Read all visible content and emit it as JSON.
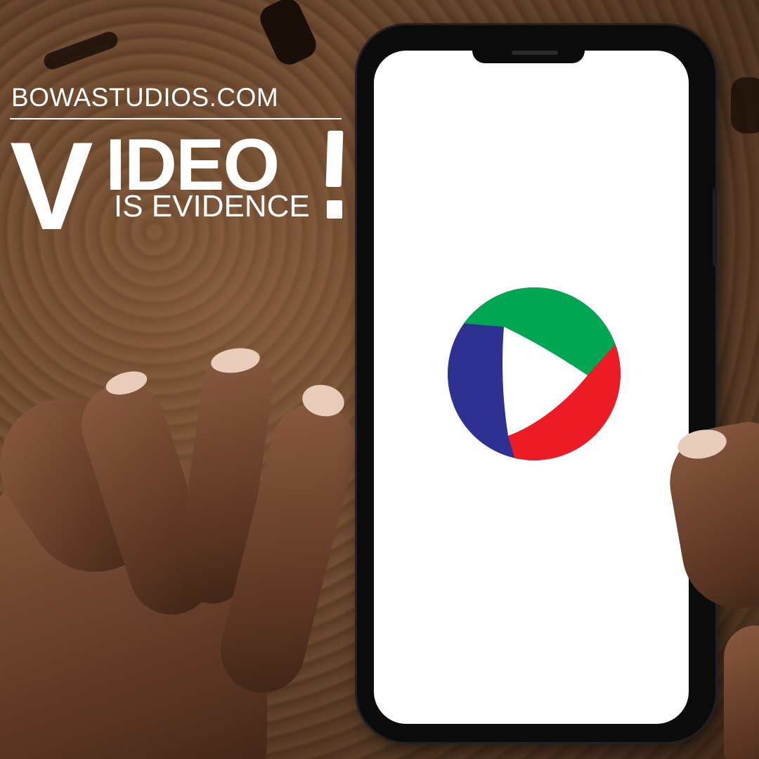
{
  "site": "BOWASTUDIOS.COM",
  "headline": {
    "big_letter": "V",
    "rest": "IDEO",
    "subline": "IS EVIDENCE",
    "exclamation": "!"
  },
  "colors": {
    "logo_green": "#00a651",
    "logo_red": "#ed1c24",
    "logo_blue": "#2e3192",
    "text": "#ffffff"
  },
  "icons": [
    "play-logo-icon"
  ]
}
